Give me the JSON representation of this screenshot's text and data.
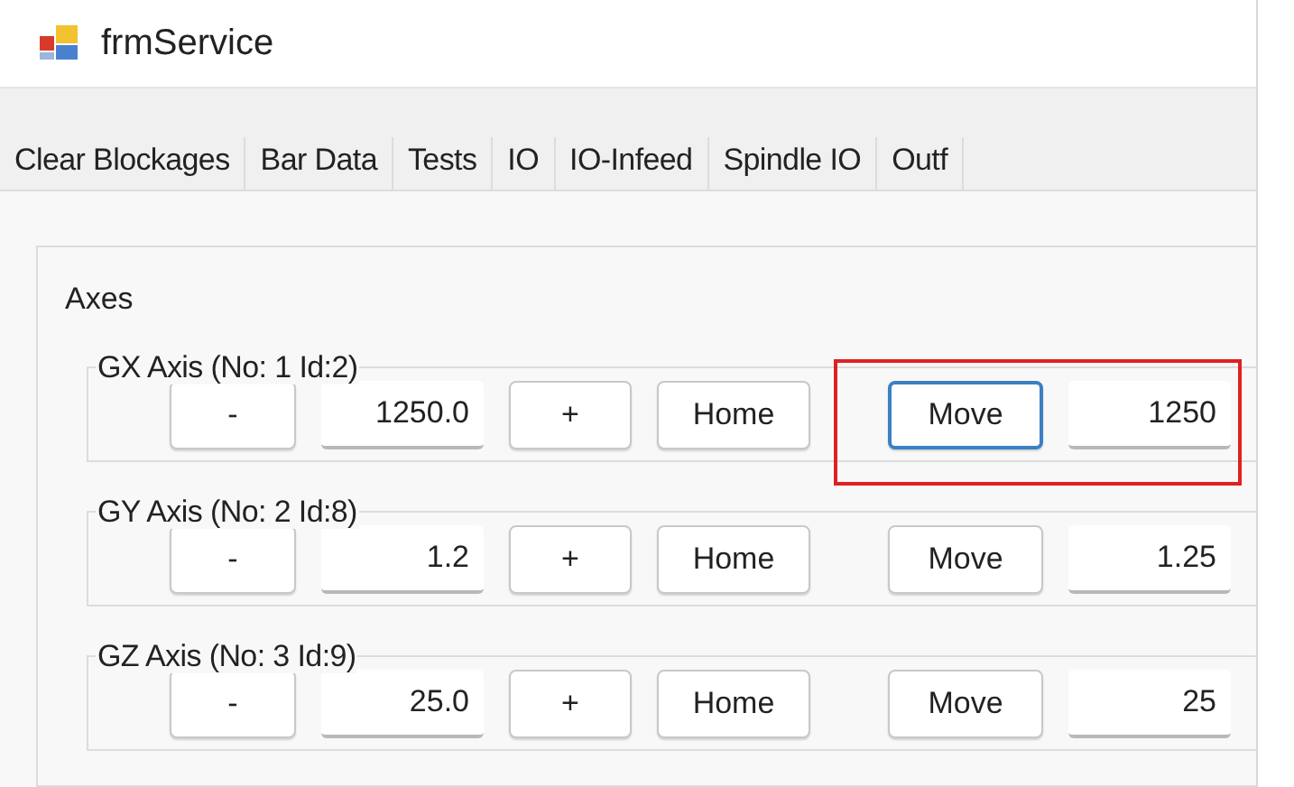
{
  "window": {
    "title": "frmService"
  },
  "tabs": [
    "Clear Blockages",
    "Bar Data",
    "Tests",
    "IO",
    "IO-Infeed",
    "Spindle IO",
    "Outf"
  ],
  "group": {
    "title": "Axes"
  },
  "axes": [
    {
      "title": "GX Axis (No: 1 Id:2)",
      "minus": "-",
      "value": "1250.0",
      "plus": "+",
      "home": "Home",
      "move": "Move",
      "target": "1250",
      "move_focused": true,
      "highlighted": true
    },
    {
      "title": "GY Axis (No: 2 Id:8)",
      "minus": "-",
      "value": "1.2",
      "plus": "+",
      "home": "Home",
      "move": "Move",
      "target": "1.25",
      "move_focused": false,
      "highlighted": false
    },
    {
      "title": "GZ Axis (No: 3 Id:9)",
      "minus": "-",
      "value": "25.0",
      "plus": "+",
      "home": "Home",
      "move": "Move",
      "target": "25",
      "move_focused": false,
      "highlighted": false
    }
  ]
}
